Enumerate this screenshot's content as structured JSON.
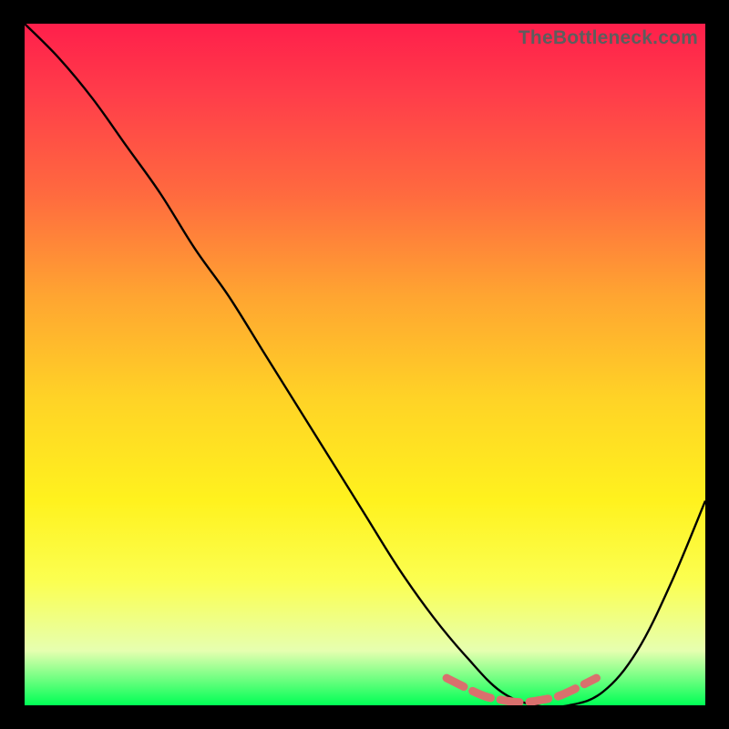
{
  "watermark": "TheBottleneck.com",
  "chart_data": {
    "type": "line",
    "title": "",
    "xlabel": "",
    "ylabel": "",
    "ylim": [
      0,
      100
    ],
    "xlim": [
      0,
      100
    ],
    "series": [
      {
        "name": "bottleneck-curve",
        "color": "#000000",
        "x": [
          0,
          5,
          10,
          15,
          20,
          25,
          30,
          35,
          40,
          45,
          50,
          55,
          60,
          65,
          70,
          75,
          80,
          85,
          90,
          95,
          100
        ],
        "values": [
          100,
          95,
          89,
          82,
          75,
          67,
          60,
          52,
          44,
          36,
          28,
          20,
          13,
          7,
          2,
          0,
          0,
          2,
          8,
          18,
          30
        ]
      },
      {
        "name": "optimal-range-marker",
        "color": "#d9706d",
        "x": [
          62,
          64,
          66,
          68,
          70,
          72,
          74,
          76,
          78,
          80,
          82,
          84
        ],
        "values": [
          4,
          3,
          2,
          1.2,
          0.8,
          0.5,
          0.5,
          0.8,
          1.2,
          2,
          3,
          4
        ]
      }
    ],
    "gradient_stops": [
      {
        "pos": 0,
        "color": "#ff1f4b"
      },
      {
        "pos": 25,
        "color": "#ff6a3f"
      },
      {
        "pos": 55,
        "color": "#ffd326"
      },
      {
        "pos": 82,
        "color": "#fbff52"
      },
      {
        "pos": 100,
        "color": "#00ff55"
      }
    ]
  }
}
